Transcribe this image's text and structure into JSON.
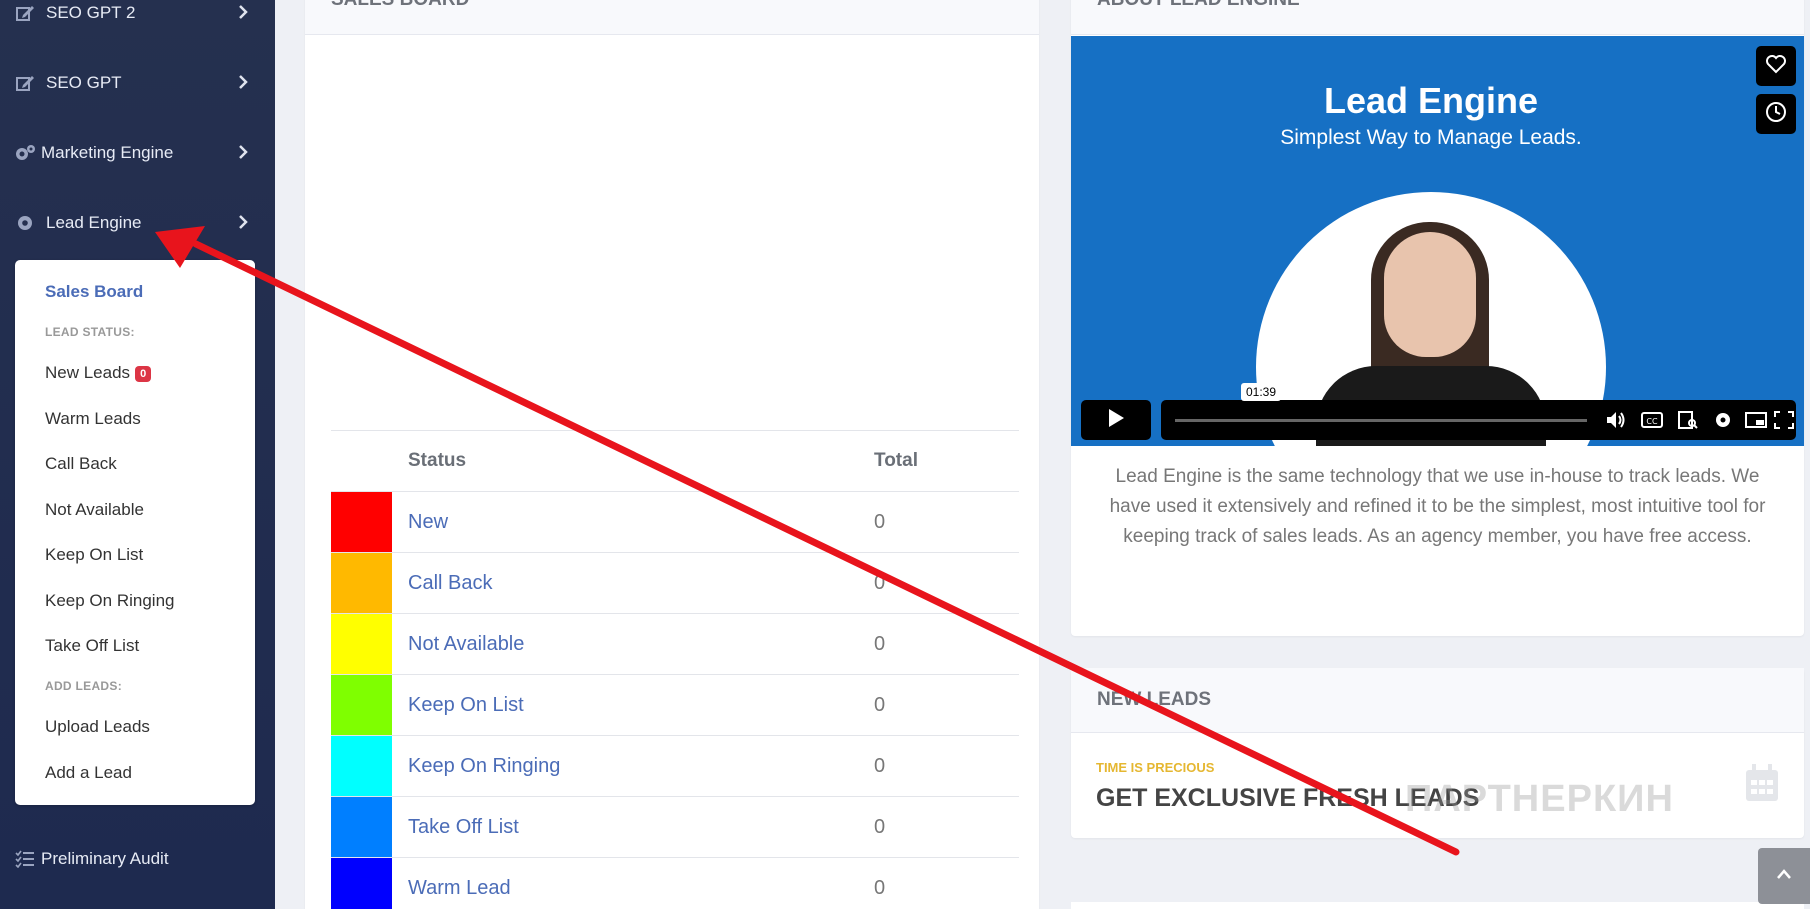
{
  "sidebar": {
    "items": [
      {
        "label": "SEO GPT 2",
        "icon": "edit-icon"
      },
      {
        "label": "SEO GPT",
        "icon": "edit-icon"
      },
      {
        "label": "Marketing Engine",
        "icon": "gears-icon"
      },
      {
        "label": "Lead Engine",
        "icon": "gear-icon"
      },
      {
        "label": "Preliminary Audit",
        "icon": "list-check-icon"
      }
    ],
    "submenu": {
      "sales_board": "Sales Board",
      "lead_status_heading": "LEAD STATUS:",
      "new_leads": "New Leads",
      "new_leads_count": "0",
      "warm_leads": "Warm Leads",
      "call_back": "Call Back",
      "not_available": "Not Available",
      "keep_on_list": "Keep On List",
      "keep_on_ringing": "Keep On Ringing",
      "take_off_list": "Take Off List",
      "add_leads_heading": "ADD LEADS:",
      "upload_leads": "Upload Leads",
      "add_a_lead": "Add a Lead"
    }
  },
  "sales_board": {
    "title": "SALES BOARD",
    "columns": {
      "status": "Status",
      "total": "Total"
    },
    "rows": [
      {
        "name": "New",
        "total": "0",
        "color": "#ff0000"
      },
      {
        "name": "Call Back",
        "total": "0",
        "color": "#ffb900"
      },
      {
        "name": "Not Available",
        "total": "0",
        "color": "#ffff00"
      },
      {
        "name": "Keep On List",
        "total": "0",
        "color": "#7fff00"
      },
      {
        "name": "Keep On Ringing",
        "total": "0",
        "color": "#00ffff"
      },
      {
        "name": "Take Off List",
        "total": "0",
        "color": "#007fff"
      },
      {
        "name": "Warm Lead",
        "total": "0",
        "color": "#0000ff"
      }
    ]
  },
  "about": {
    "title": "ABOUT LEAD ENGINE",
    "video_title": "Lead Engine",
    "video_subtitle": "Simplest Way to Manage Leads.",
    "video_time": "01:39",
    "description": "Lead Engine is the same technology that we use in-house to track leads. We have used it extensively and refined it to be the simplest, most intuitive tool for keeping track of sales leads. As an agency member, you have free access."
  },
  "new_leads": {
    "title": "NEW LEADS",
    "eyebrow": "TIME IS PRECIOUS",
    "headline": "GET EXCLUSIVE FRESH LEADS"
  },
  "watermark": "ПАРТНЕРКИН",
  "colors": {
    "sidebar_bg": "#25304f",
    "link": "#4b6cb7",
    "video_bg": "#1670c4",
    "badge": "#dc3545",
    "eyebrow": "#e5b731",
    "annotation_arrow": "#e8141c"
  }
}
